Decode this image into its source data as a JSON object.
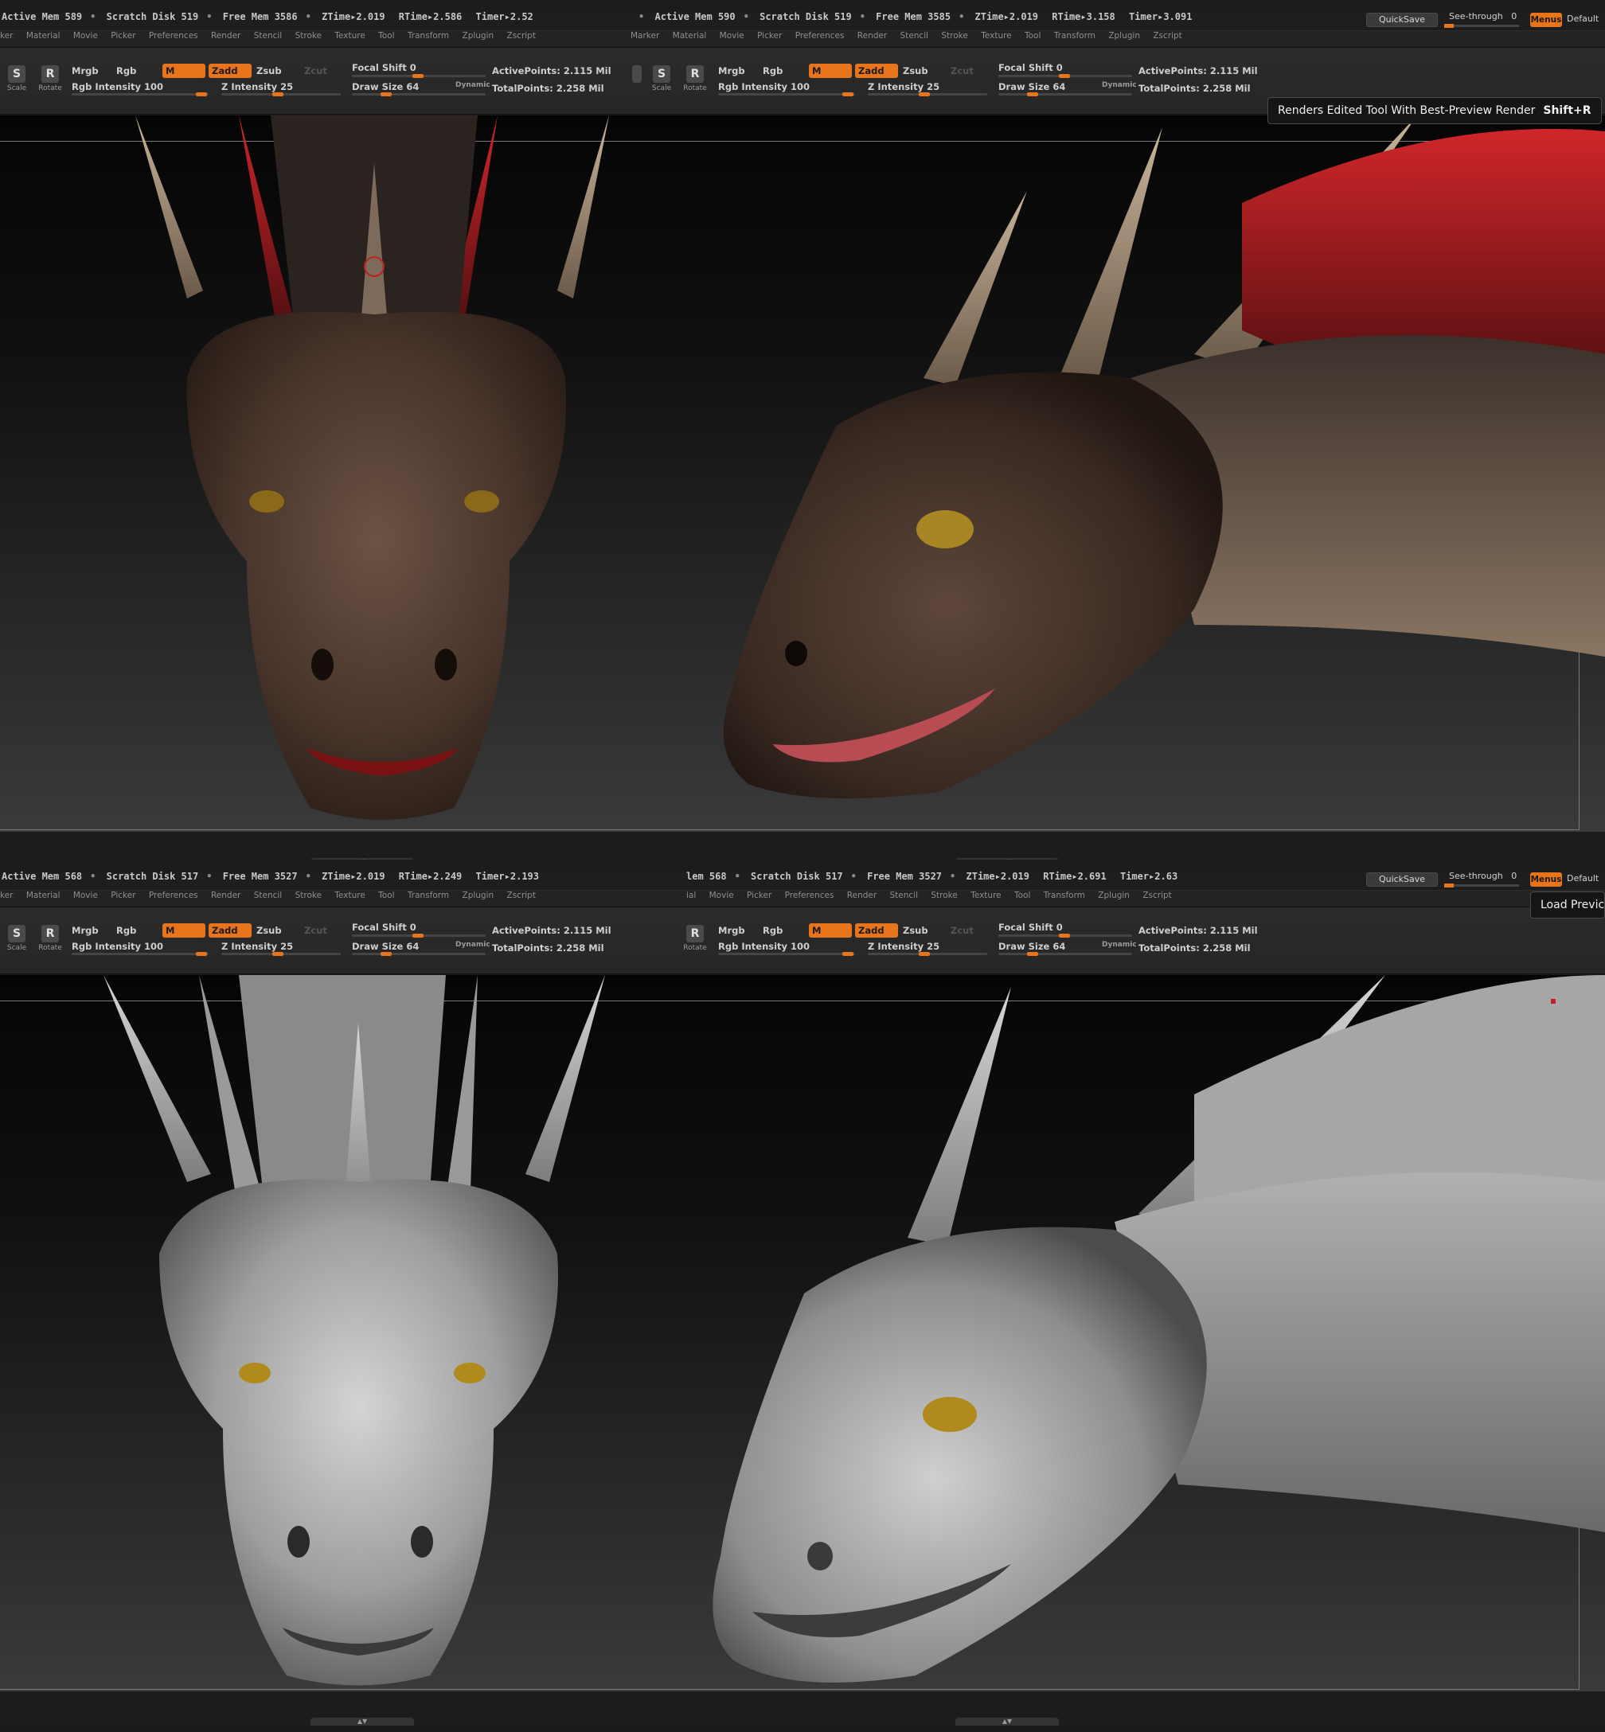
{
  "colors": {
    "accent": "#e8741c",
    "polypaint_head": "#5a4438",
    "polypaint_fin": "#b3262a",
    "eye": "#b0861a",
    "clay": "#a8a8a8",
    "background": "#1c1c1c"
  },
  "top": {
    "left": {
      "status": [
        "Active Mem 589",
        "Scratch Disk 519",
        "Free Mem 3586",
        "ZTime▸2.019",
        "RTime▸2.586",
        "Timer▸2.52"
      ],
      "menus": [
        "ker",
        "Material",
        "Movie",
        "Picker",
        "Preferences",
        "Render",
        "Stencil",
        "Stroke",
        "Texture",
        "Tool",
        "Transform",
        "Zplugin",
        "Zscript"
      ],
      "rgb_intensity": "Rgb Intensity 100",
      "z_intensity": "Z Intensity 25",
      "focal_shift": "Focal Shift 0",
      "draw_size": "Draw Size 64",
      "active_points": "ActivePoints: 2.115 Mil",
      "total_points": "TotalPoints: 2.258 Mil"
    },
    "right": {
      "status": [
        "Active Mem 590",
        "Scratch Disk 519",
        "Free Mem 3585",
        "ZTime▸2.019",
        "RTime▸3.158",
        "Timer▸3.091"
      ],
      "menus": [
        "Marker",
        "Material",
        "Movie",
        "Picker",
        "Preferences",
        "Render",
        "Stencil",
        "Stroke",
        "Texture",
        "Tool",
        "Transform",
        "Zplugin",
        "Zscript"
      ],
      "rgb_intensity": "Rgb Intensity 100",
      "z_intensity": "Z Intensity 25",
      "focal_shift": "Focal Shift 0",
      "draw_size": "Draw Size 64",
      "active_points": "ActivePoints: 2.115 Mil",
      "total_points": "TotalPoints: 2.258 Mil"
    },
    "tooltip_text": "Renders Edited Tool With Best-Preview Render",
    "tooltip_shortcut": "Shift+R"
  },
  "bottom": {
    "left": {
      "status": [
        "Active Mem 568",
        "Scratch Disk 517",
        "Free Mem 3527",
        "ZTime▸2.019",
        "RTime▸2.249",
        "Timer▸2.193"
      ],
      "menus": [
        "ker",
        "Material",
        "Movie",
        "Picker",
        "Preferences",
        "Render",
        "Stencil",
        "Stroke",
        "Texture",
        "Tool",
        "Transform",
        "Zplugin",
        "Zscript"
      ],
      "rgb_intensity": "Rgb Intensity 100",
      "z_intensity": "Z Intensity 25",
      "focal_shift": "Focal Shift 0",
      "draw_size": "Draw Size 64",
      "active_points": "ActivePoints: 2.115 Mil",
      "total_points": "TotalPoints: 2.258 Mil"
    },
    "right": {
      "status": [
        "lem 568",
        "Scratch Disk 517",
        "Free Mem 3527",
        "ZTime▸2.019",
        "RTime▸2.691",
        "Timer▸2.63"
      ],
      "menus": [
        "ial",
        "Movie",
        "Picker",
        "Preferences",
        "Render",
        "Stencil",
        "Stroke",
        "Texture",
        "Tool",
        "Transform",
        "Zplugin",
        "Zscript"
      ],
      "rgb_intensity": "Rgb Intensity 100",
      "z_intensity": "Z Intensity 25",
      "focal_shift": "Focal Shift 0",
      "draw_size": "Draw Size 64",
      "active_points": "ActivePoints: 2.115 Mil",
      "total_points": "TotalPoints: 2.258 Mil"
    },
    "tooltip_text": "Load Previc"
  },
  "shelf": {
    "mrgb": "Mrgb",
    "rgb": "Rgb",
    "m": "M",
    "zadd": "Zadd",
    "zsub": "Zsub",
    "zcut": "Zcut",
    "dynamic": "Dynamic",
    "scale": "Scale",
    "rotate": "Rotate",
    "scale_glyph": "S",
    "rotate_glyph": "R"
  },
  "right_controls": {
    "quicksave": "QuickSave",
    "see_through": "See-through",
    "see_through_value": "0",
    "menus": "Menus",
    "default": "Default"
  },
  "icons": [
    "scale-icon",
    "rotate-icon",
    "move-icon",
    "resize-handle-icon"
  ]
}
